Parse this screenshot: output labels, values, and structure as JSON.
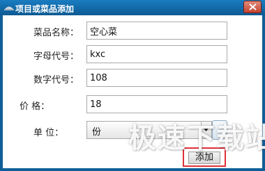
{
  "window": {
    "title": "项目或菜品添加"
  },
  "form": {
    "name_label": "菜品名称：",
    "name_value": "空心菜",
    "letter_code_label": "字母代号：",
    "letter_code_value": "kxc",
    "number_code_label": "数字代号：",
    "number_code_value": "108",
    "price_label": "价    格：",
    "price_value": "18",
    "unit_label": "单    位：",
    "unit_value": "份"
  },
  "buttons": {
    "add_label": "添加"
  },
  "watermark": {
    "text": "极速下载站"
  },
  "icons": {
    "app": "app-icon",
    "close": "close-icon",
    "dropdown": "chevron-down-icon"
  }
}
